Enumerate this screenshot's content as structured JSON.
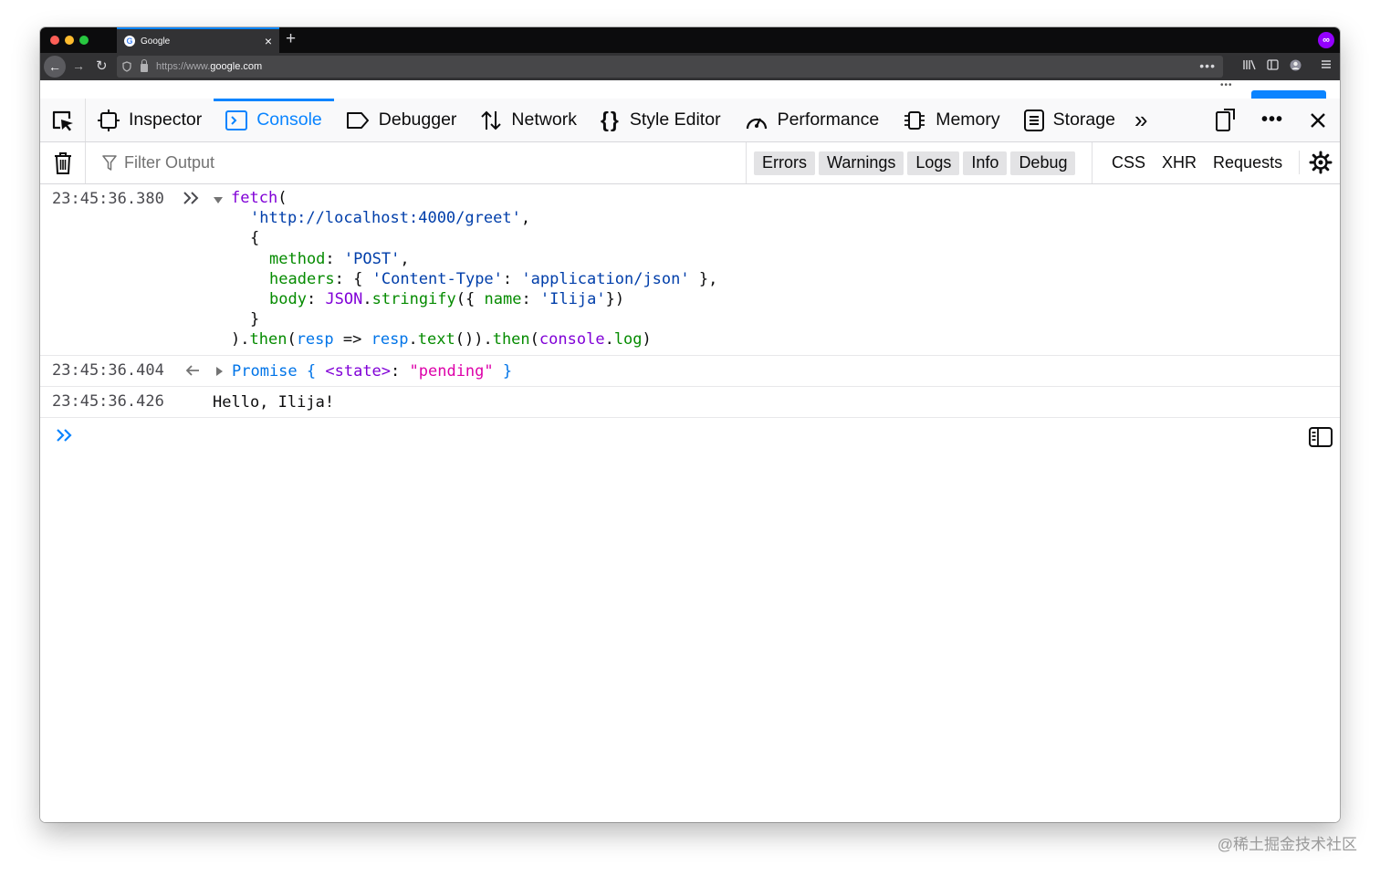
{
  "browser": {
    "tab_title": "Google",
    "tab_favicon": "G",
    "tab_close": "×",
    "new_tab": "+",
    "url_protocol": "https://www.",
    "url_host": "google.com",
    "ext_label": "∞"
  },
  "devtools": {
    "tabs": [
      {
        "label": "Inspector",
        "icon": "inspector-icon"
      },
      {
        "label": "Console",
        "icon": "console-icon",
        "selected": true
      },
      {
        "label": "Debugger",
        "icon": "debugger-icon"
      },
      {
        "label": "Network",
        "icon": "network-icon"
      },
      {
        "label": "Style Editor",
        "icon": "style-editor-icon"
      },
      {
        "label": "Performance",
        "icon": "performance-icon"
      },
      {
        "label": "Memory",
        "icon": "memory-icon"
      },
      {
        "label": "Storage",
        "icon": "storage-icon"
      }
    ],
    "filter_placeholder": "Filter Output",
    "log_filters": [
      "Errors",
      "Warnings",
      "Logs",
      "Info",
      "Debug"
    ],
    "net_filters": [
      "CSS",
      "XHR",
      "Requests"
    ]
  },
  "console": {
    "messages": [
      {
        "timestamp": "23:45:36.380",
        "code": {
          "l1_fn": "fetch",
          "l1_paren": "(",
          "l2_url": "'http://localhost:4000/greet'",
          "l2_comma": ",",
          "l3_brace": "{",
          "l4_key": "method",
          "l4_colon": ": ",
          "l4_val": "'POST'",
          "l4_comma": ",",
          "l5_key": "headers",
          "l5_colon": ": { ",
          "l5_hkey": "'Content-Type'",
          "l5_hcolon": ": ",
          "l5_hval": "'application/json'",
          "l5_end": " },",
          "l6_key": "body",
          "l6_colon": ": ",
          "l6_json": "JSON",
          "l6_dot": ".",
          "l6_stringify": "stringify",
          "l6_open": "({ ",
          "l6_name": "name",
          "l6_ncolon": ": ",
          "l6_nval": "'Ilija'",
          "l6_close": "})",
          "l7_brace": "}",
          "l8_a": ").",
          "l8_then1": "then",
          "l8_b": "(",
          "l8_resp1": "resp",
          "l8_arrow": " => ",
          "l8_resp2": "resp",
          "l8_c": ".",
          "l8_text": "text",
          "l8_d": "()).",
          "l8_then2": "then",
          "l8_e": "(",
          "l8_console": "console",
          "l8_f": ".",
          "l8_log": "log",
          "l8_g": ")"
        }
      },
      {
        "timestamp": "23:45:36.404",
        "promise": "Promise",
        "open": " { ",
        "state_key": "<state>",
        "state_colon": ": ",
        "state_val": "\"pending\"",
        "close": " }"
      },
      {
        "timestamp": "23:45:36.426",
        "text": "Hello, Ilija!"
      }
    ]
  },
  "watermark": "@稀土掘金技术社区",
  "colors": {
    "accent": "#0a84ff",
    "fn_purple": "#8000d7",
    "string_blue": "#003eaa",
    "key_green": "#058b00",
    "state_pink": "#dd00a9"
  }
}
